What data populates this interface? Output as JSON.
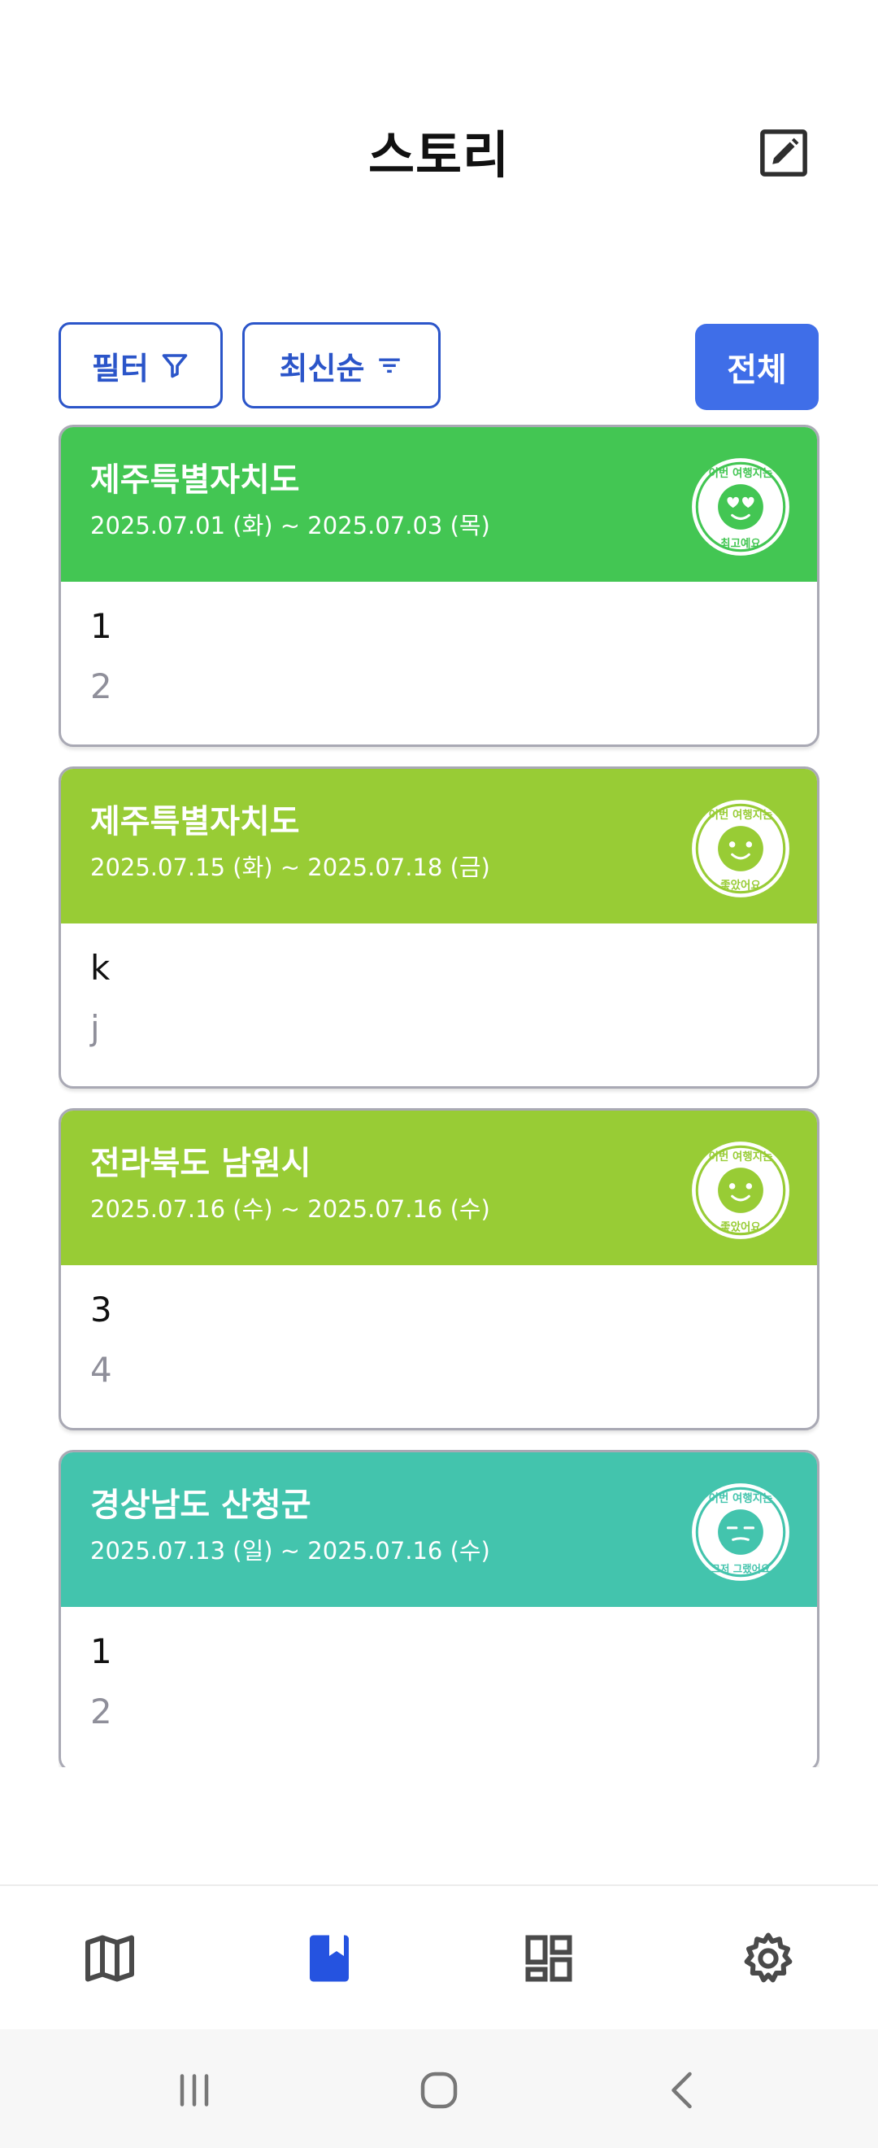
{
  "header": {
    "title": "스토리",
    "edit_icon": "edit-icon"
  },
  "toolbar": {
    "filter_label": "필터",
    "filter_icon": "funnel-icon",
    "sort_label": "최신순",
    "sort_icon": "sort-lines-icon",
    "all_label": "전체"
  },
  "stories": [
    {
      "region": "제주특별자치도",
      "dates": "2025.07.01 (화) ~ 2025.07.03 (목)",
      "line1": "1",
      "line2": "2",
      "color": "#43c653",
      "stamp_top": "이번 여행지는",
      "stamp_bottom": "최고예요",
      "stamp_face": "heart-eyes"
    },
    {
      "region": "제주특별자치도",
      "dates": "2025.07.15 (화) ~ 2025.07.18 (금)",
      "line1": "k",
      "line2": "j",
      "color": "#98cc35",
      "stamp_top": "이번 여행지는",
      "stamp_bottom": "좋았어요",
      "stamp_face": "smile"
    },
    {
      "region": "전라북도 남원시",
      "dates": "2025.07.16 (수) ~ 2025.07.16 (수)",
      "line1": "3",
      "line2": "4",
      "color": "#98cc35",
      "stamp_top": "이번 여행지는",
      "stamp_bottom": "좋았어요",
      "stamp_face": "smile"
    },
    {
      "region": "경상남도 산청군",
      "dates": "2025.07.13 (일) ~ 2025.07.16 (수)",
      "line1": "1",
      "line2": "2",
      "color": "#43c4ad",
      "stamp_top": "이번 여행지는",
      "stamp_bottom": "그저 그랬어요",
      "stamp_face": "meh"
    }
  ],
  "bottom_nav": [
    {
      "icon": "map-icon",
      "active": false
    },
    {
      "icon": "bookmark-icon",
      "active": true
    },
    {
      "icon": "dashboard-icon",
      "active": false
    },
    {
      "icon": "gear-icon",
      "active": false
    }
  ],
  "colors": {
    "accent": "#3f6ee8",
    "outline": "#2b55c9",
    "active_nav": "#2553e0",
    "inactive_nav": "#4a4a4a"
  }
}
